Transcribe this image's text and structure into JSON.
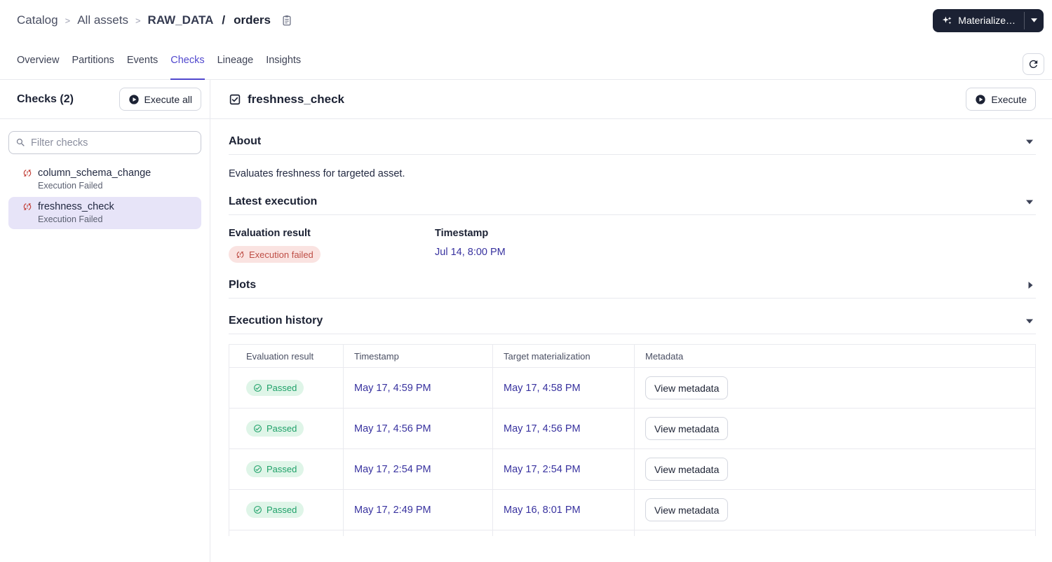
{
  "breadcrumb": {
    "catalog": "Catalog",
    "all_assets": "All assets",
    "sep": ">",
    "group": "RAW_DATA",
    "slash": "/",
    "asset": "orders"
  },
  "header": {
    "materialize_label": "Materialize…"
  },
  "tabs": [
    {
      "label": "Overview",
      "active": false
    },
    {
      "label": "Partitions",
      "active": false
    },
    {
      "label": "Events",
      "active": false
    },
    {
      "label": "Checks",
      "active": true
    },
    {
      "label": "Lineage",
      "active": false
    },
    {
      "label": "Insights",
      "active": false
    }
  ],
  "sidebar": {
    "title": "Checks (2)",
    "execute_all_label": "Execute all",
    "filter_placeholder": "Filter checks",
    "items": [
      {
        "name": "column_schema_change",
        "status": "Execution Failed",
        "selected": false
      },
      {
        "name": "freshness_check",
        "status": "Execution Failed",
        "selected": true
      }
    ]
  },
  "main": {
    "title": "freshness_check",
    "execute_label": "Execute",
    "about": {
      "title": "About",
      "description": "Evaluates freshness for targeted asset."
    },
    "latest": {
      "title": "Latest execution",
      "result_label": "Evaluation result",
      "result_value": "Execution failed",
      "timestamp_label": "Timestamp",
      "timestamp_value": "Jul 14, 8:00 PM"
    },
    "plots": {
      "title": "Plots"
    },
    "history": {
      "title": "Execution history",
      "columns": [
        "Evaluation result",
        "Timestamp",
        "Target materialization",
        "Metadata"
      ],
      "rows": [
        {
          "result": "Passed",
          "timestamp": "May 17, 4:59 PM",
          "target": "May 17, 4:58 PM",
          "metadata_label": "View metadata"
        },
        {
          "result": "Passed",
          "timestamp": "May 17, 4:56 PM",
          "target": "May 17, 4:56 PM",
          "metadata_label": "View metadata"
        },
        {
          "result": "Passed",
          "timestamp": "May 17, 2:54 PM",
          "target": "May 17, 2:54 PM",
          "metadata_label": "View metadata"
        },
        {
          "result": "Passed",
          "timestamp": "May 17, 2:49 PM",
          "target": "May 16, 8:01 PM",
          "metadata_label": "View metadata"
        }
      ]
    }
  },
  "colors": {
    "accent_purple": "#5148CE",
    "link_indigo": "#38329F",
    "error_bg": "#FAE3E1",
    "error_text": "#BE4E46",
    "success_bg": "#DFF5E8",
    "success_text": "#1FA169",
    "selected_item_bg": "#E7E4F8",
    "dark_navy": "#1C2234",
    "materialize_btn_bg": "#1B2133"
  }
}
